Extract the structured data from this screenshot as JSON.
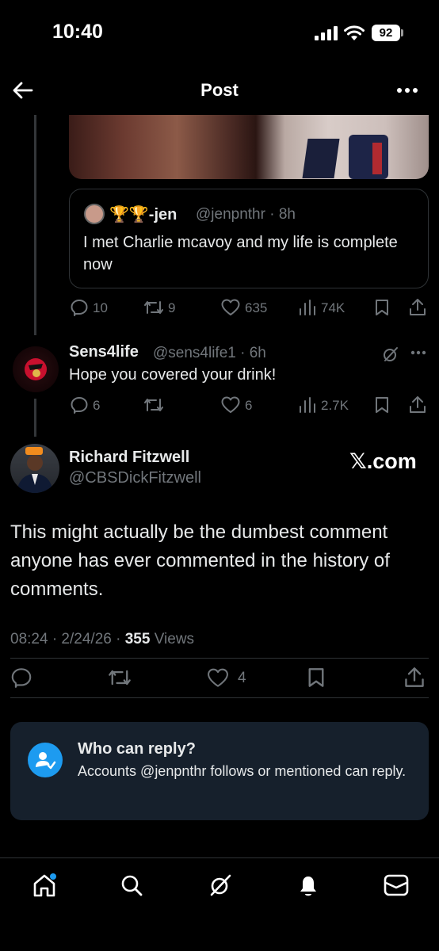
{
  "status_bar": {
    "time": "10:40",
    "battery": "92"
  },
  "header": {
    "title": "Post"
  },
  "quoted_post": {
    "display_name": "🏆🏆-jen",
    "handle_time": "@jenpnthr · 8h",
    "text": "I met Charlie mcavoy and my life is complete now"
  },
  "parent_metrics": {
    "replies": "10",
    "reposts": "9",
    "likes": "635",
    "views": "74K"
  },
  "reply": {
    "display_name": "Sens4life",
    "handle_time": "@sens4life1 · 6h",
    "text": "Hope you covered your drink!",
    "metrics": {
      "replies": "6",
      "reposts": "",
      "likes": "6",
      "views": "2.7K"
    }
  },
  "main_post": {
    "display_name": "Richard Fitzwell",
    "handle": "@CBSDickFitzwell",
    "watermark": "𝕏.com",
    "text": "This might actually be the dumbest comment anyone has ever commented in the history of comments.",
    "time_date": "08:24 · 2/24/26 · ",
    "view_count": "355",
    "views_label": " Views",
    "likes": "4"
  },
  "reply_restriction": {
    "title": "Who can reply?",
    "text": "Accounts @jenpnthr follows or mentioned can reply."
  },
  "colors": {
    "accent": "#1d9bf0",
    "muted": "#71767b",
    "card": "#16202c"
  },
  "icons": [
    "back-arrow-icon",
    "more-icon",
    "reply-icon",
    "repost-icon",
    "like-icon",
    "views-icon",
    "bookmark-icon",
    "share-icon",
    "grok-icon",
    "home-icon",
    "search-icon",
    "notifications-icon",
    "messages-icon"
  ]
}
